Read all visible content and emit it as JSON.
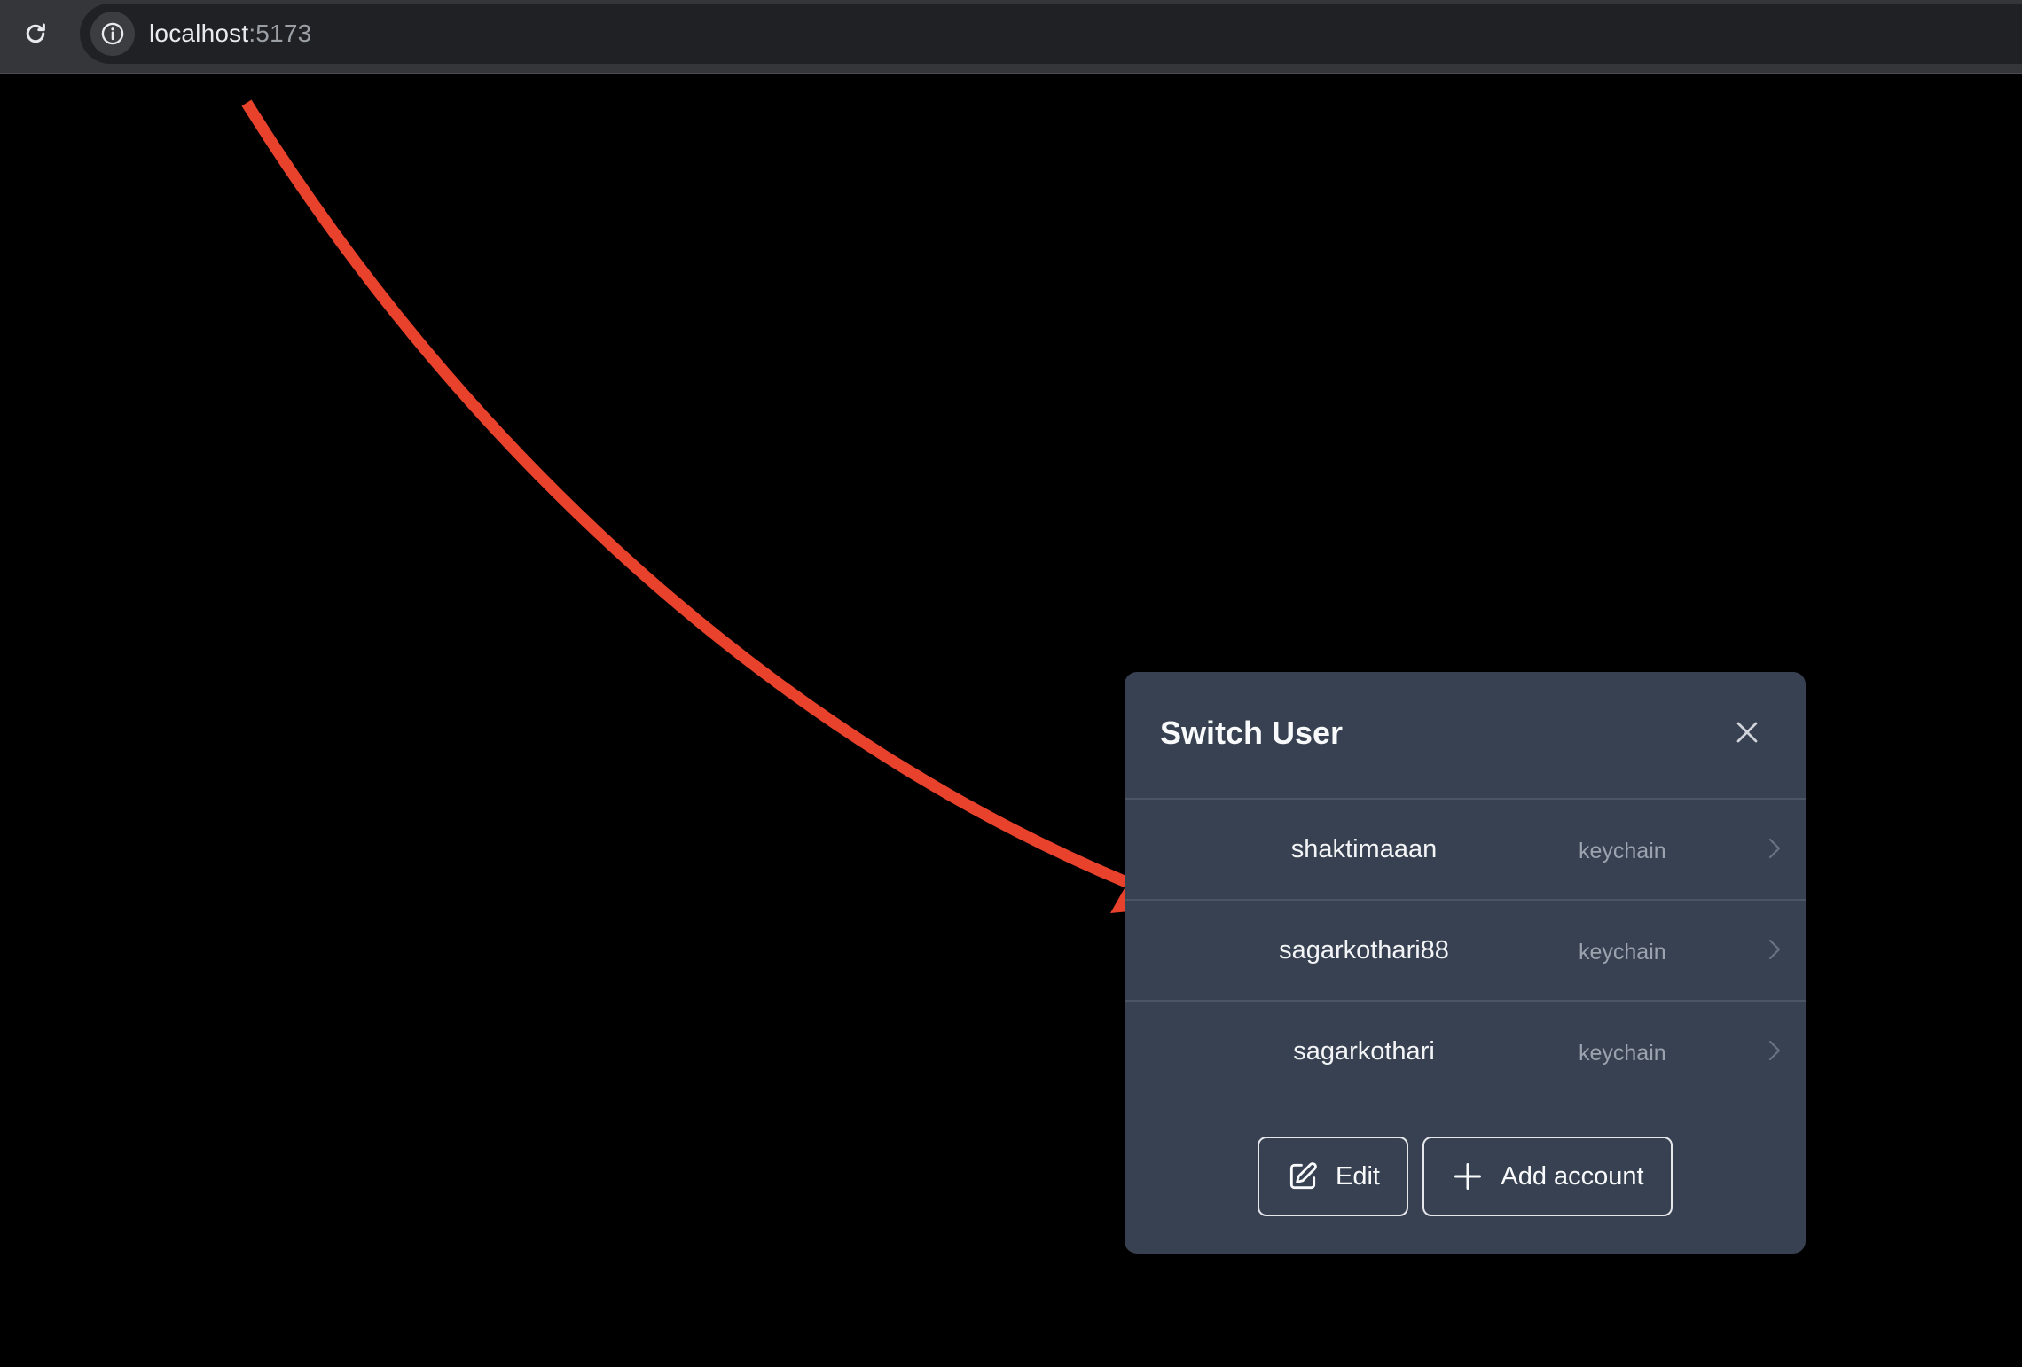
{
  "browser": {
    "url_host": "localhost",
    "url_port": ":5173"
  },
  "modal": {
    "title": "Switch User",
    "users": [
      {
        "name": "shaktimaaan",
        "type": "keychain"
      },
      {
        "name": "sagarkothari88",
        "type": "keychain"
      },
      {
        "name": "sagarkothari",
        "type": "keychain"
      }
    ],
    "actions": {
      "edit_label": "Edit",
      "add_account_label": "Add account"
    }
  },
  "colors": {
    "page_background": "#000000",
    "modal_background": "#374151",
    "annotation_arrow": "#e8412c"
  },
  "icons": {
    "reload": "reload-icon",
    "site_info": "info-icon",
    "close": "close-icon",
    "row_chevron": "chevron-right-icon",
    "edit": "edit-icon",
    "add": "plus-icon"
  }
}
